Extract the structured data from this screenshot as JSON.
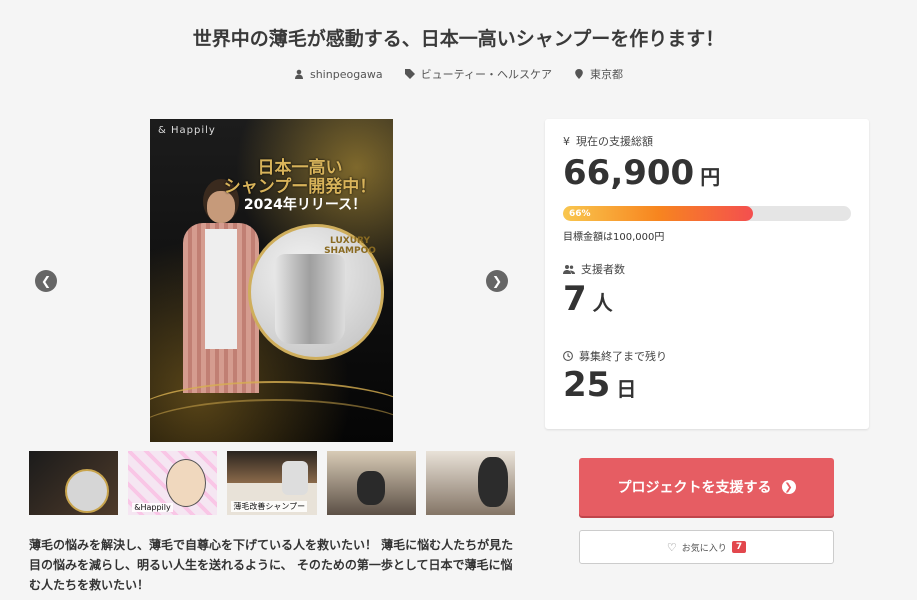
{
  "project": {
    "title": "世界中の薄毛が感動する、日本一高いシャンプーを作ります！",
    "owner": "shinpeogawa",
    "category": "ビューティー・ヘルスケア",
    "location": "東京都"
  },
  "hero": {
    "brand": "& Happily",
    "headline": "日本一高い\nシャンプー開発中！",
    "release": "2024年リリース！",
    "badge": "LUXURY\nSHAMPOO"
  },
  "thumbnails": [
    {
      "label": ""
    },
    {
      "label": "&Happily"
    },
    {
      "label": "薄毛改善シャンプー"
    },
    {
      "label": ""
    },
    {
      "label": ""
    }
  ],
  "description": "薄毛の悩みを解決し、薄毛で自尊心を下げている人を救いたい！ 薄毛に悩む人たちが見た目の悩みを減らし、明るい人生を送れるように、 そのための第一歩として日本で薄毛に悩む人たちを救いたい！",
  "stats": {
    "raised_label": "現在の支援総額",
    "raised_amount": "66,900",
    "currency_unit": "円",
    "progress_text": "66%",
    "progress_value": 0.66,
    "goal_text": "目標金額は100,000円",
    "backers_label": "支援者数",
    "backers_count": "7",
    "backers_unit": "人",
    "remaining_label": "募集終了まで残り",
    "remaining_count": "25",
    "remaining_unit": "日"
  },
  "actions": {
    "support_label": "プロジェクトを支援する",
    "favorite_label": "お気に入り",
    "favorite_count": "7"
  },
  "icons": {
    "prev": "chevron-left-icon",
    "next": "chevron-right-icon",
    "user": "user-icon",
    "tag": "tag-icon",
    "location": "map-pin-icon",
    "yen": "yen-icon",
    "users": "users-icon",
    "clock": "clock-icon",
    "heart": "heart-icon"
  },
  "colors": {
    "accent": "#e65d63",
    "progress_start": "#f9c74f",
    "progress_end": "#f44f4f"
  }
}
